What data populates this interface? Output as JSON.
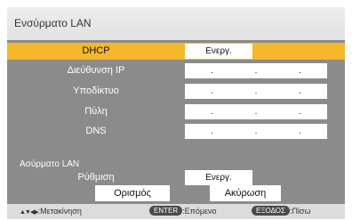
{
  "title": "Ενσύρματο LAN",
  "wired": {
    "dhcp": {
      "label": "DHCP",
      "value": "Ενεργ."
    },
    "ip_address": {
      "label": "Διεύθυνση IP",
      "value": ".   .   ."
    },
    "subnet": {
      "label": "Υποδίκτυο",
      "value": ".   .   ."
    },
    "gateway": {
      "label": "Πύλη",
      "value": ".   .   ."
    },
    "dns": {
      "label": "DNS",
      "value": ".   .   ."
    }
  },
  "wireless": {
    "section_label": "Ασύρματο LAN",
    "setting": {
      "label": "Ρύθμιση",
      "value": "Ενεργ."
    }
  },
  "buttons": {
    "set": "Ορισμός",
    "cancel": "Ακύρωση"
  },
  "help": {
    "move_icons": "▲▼◀▶",
    "move_label": ":Μετακίνηση",
    "enter_key": "ENTER",
    "enter_label": ":Επόμενο",
    "exit_key": "ΕΞΟΔΟΣ",
    "exit_label": ":Πίσω"
  },
  "colors": {
    "selected_row": "#f5b82a",
    "panel": "#8b8b8b"
  }
}
